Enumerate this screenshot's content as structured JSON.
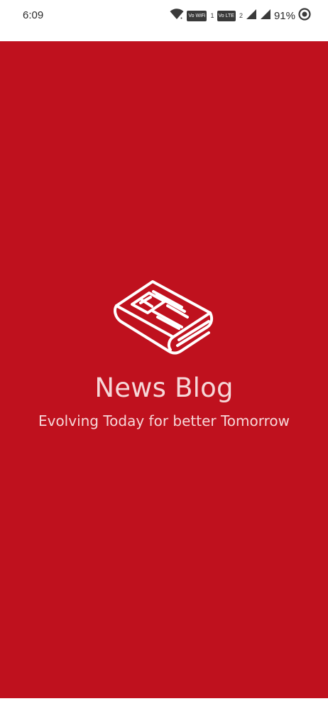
{
  "status_bar": {
    "time": "6:09",
    "battery": "91%",
    "badge_wifi": "Vo WiFi",
    "badge_wifi_sub": "1",
    "badge_lte": "Vo LTE",
    "badge_lte_sub": "2",
    "icons": [
      "wifi-icon",
      "signal-icon",
      "signal-icon",
      "battery-saver-icon"
    ]
  },
  "splash": {
    "title": "News Blog",
    "tagline": "Evolving Today for better Tomorrow",
    "logo_icon": "newspaper-icon",
    "background_color": "#bf111e",
    "text_color": "#f6d7d8"
  }
}
